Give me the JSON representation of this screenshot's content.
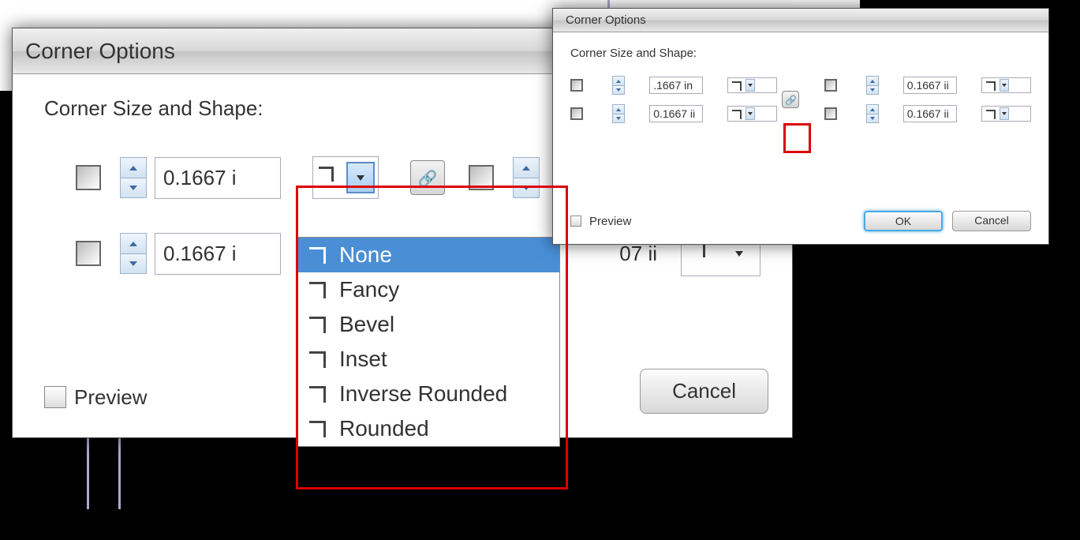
{
  "large_dialog": {
    "title": "Corner Options",
    "section": "Corner Size and Shape:",
    "tl_value": "0.1667 i",
    "bl_value": "0.1667 i",
    "tr_value_partial": "07 ii",
    "preview_label": "Preview",
    "cancel_label": "Cancel"
  },
  "dropdown": {
    "options": [
      "None",
      "Fancy",
      "Bevel",
      "Inset",
      "Inverse Rounded",
      "Rounded"
    ],
    "selected": "None"
  },
  "small_dialog": {
    "title": "Corner Options",
    "section": "Corner Size and Shape:",
    "tl_value": ".1667 in",
    "tr_value": "0.1667 ii",
    "bl_value": "0.1667 ii",
    "br_value": "0.1667 ii",
    "preview_label": "Preview",
    "ok_label": "OK",
    "cancel_label": "Cancel"
  }
}
